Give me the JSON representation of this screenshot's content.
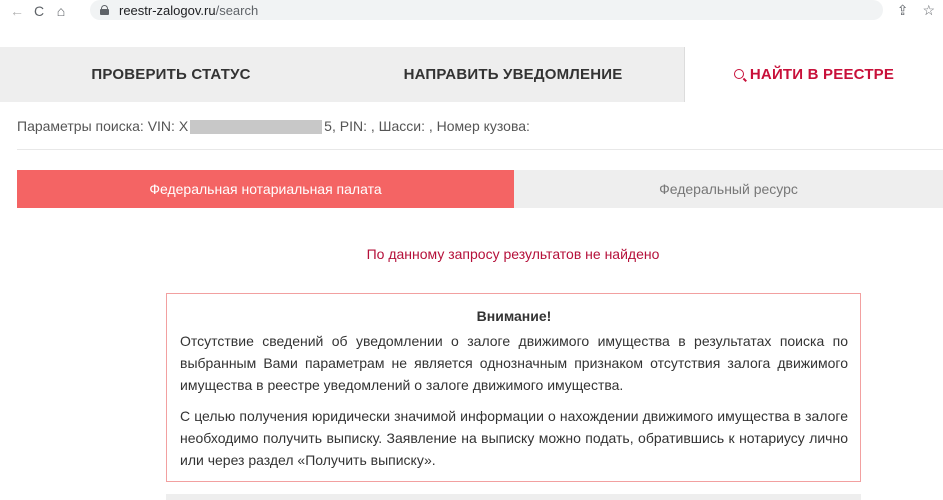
{
  "browser": {
    "url_host": "reestr-zalogov.ru",
    "url_path": "/search",
    "back_icon": "←",
    "reload_icon": "C",
    "home_icon": "⌂",
    "share_icon": "⇪",
    "star_icon": "☆"
  },
  "tabs": [
    {
      "label": "ПРОВЕРИТЬ СТАТУС"
    },
    {
      "label": "НАПРАВИТЬ УВЕДОМЛЕНИЕ"
    },
    {
      "label": "НАЙТИ В РЕЕСТРЕ",
      "icon": "search-icon",
      "active": true
    }
  ],
  "search_params": {
    "prefix": "Параметры поиска: VIN: Х",
    "suffix": "5, PIN: , Шасси: , Номер кузова:"
  },
  "sources": {
    "active": "Федеральная нотариальная палата",
    "inactive": "Федеральный ресурс"
  },
  "no_results": "По данному запросу результатов не найдено",
  "warning": {
    "title": "Внимание!",
    "paragraph1": "Отсутствие сведений об уведомлении о залоге движимого имущества в результатах поиска по выбранным Вами параметрам не является однозначным признаком отсутствия залога движимого имущества в реестре уведомлений о залоге движимого имущества.",
    "paragraph2": "С целью получения юридически значимой информации о нахождении движимого имущества в залоге необходимо получить выписку. Заявление на выписку можно подать, обратившись к нотариусу лично или через раздел «Получить выписку»."
  },
  "colors": {
    "accent": "#c8103a",
    "active_source_bg": "#f46464",
    "tab_bg": "#eeeeee"
  }
}
